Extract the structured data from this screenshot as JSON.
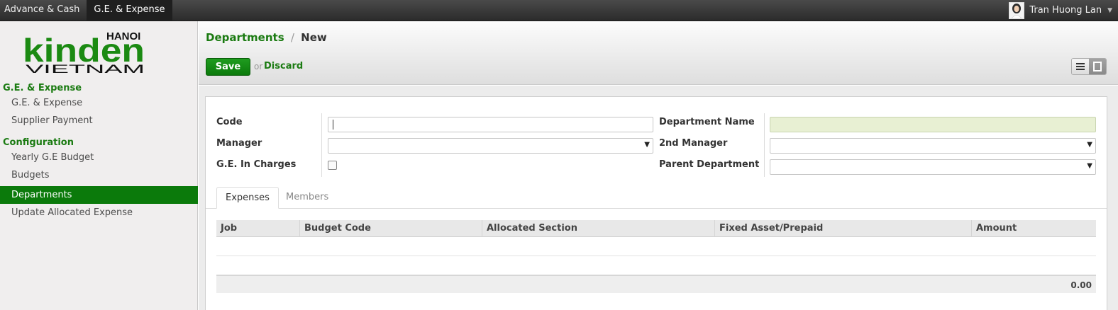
{
  "topbar": {
    "menu": [
      "Advance & Cash",
      "G.E. & Expense"
    ],
    "user": "Tran Huong Lan"
  },
  "sidebar": {
    "logo": {
      "city": "HANOI",
      "brand": "kinden",
      "country": "VIETNAM"
    },
    "sections": [
      {
        "title": "G.E. & Expense",
        "items": [
          "G.E. & Expense",
          "Supplier Payment"
        ]
      },
      {
        "title": "Configuration",
        "items": [
          "Yearly G.E Budget",
          "Budgets",
          "Departments",
          "Update Allocated Expense"
        ]
      }
    ],
    "active_item": "Departments"
  },
  "header": {
    "breadcrumb_parent": "Departments",
    "breadcrumb_sep": "/",
    "breadcrumb_current": "New",
    "save_label": "Save",
    "or_label": "or",
    "discard_label": "Discard"
  },
  "form": {
    "labels": {
      "code": "Code",
      "manager": "Manager",
      "ge_in_charges": "G.E. In Charges",
      "department_name": "Department Name",
      "second_manager": "2nd Manager",
      "parent_department": "Parent Department"
    },
    "values": {
      "code": "",
      "manager": "",
      "ge_in_charges": false,
      "department_name": "",
      "second_manager": "",
      "parent_department": ""
    }
  },
  "tabs": [
    "Expenses",
    "Members"
  ],
  "active_tab": "Expenses",
  "table": {
    "columns": [
      "Job",
      "Budget Code",
      "Allocated Section",
      "Fixed Asset/Prepaid",
      "Amount"
    ],
    "rows": [],
    "total": "0.00"
  },
  "colors": {
    "accent": "#0b7a0b",
    "link": "#1b7b12",
    "required_field": "#e8f0d3"
  },
  "icons": {
    "list_view": "list-view-icon",
    "form_view": "form-view-icon",
    "dropdown": "chevron-down-icon"
  }
}
